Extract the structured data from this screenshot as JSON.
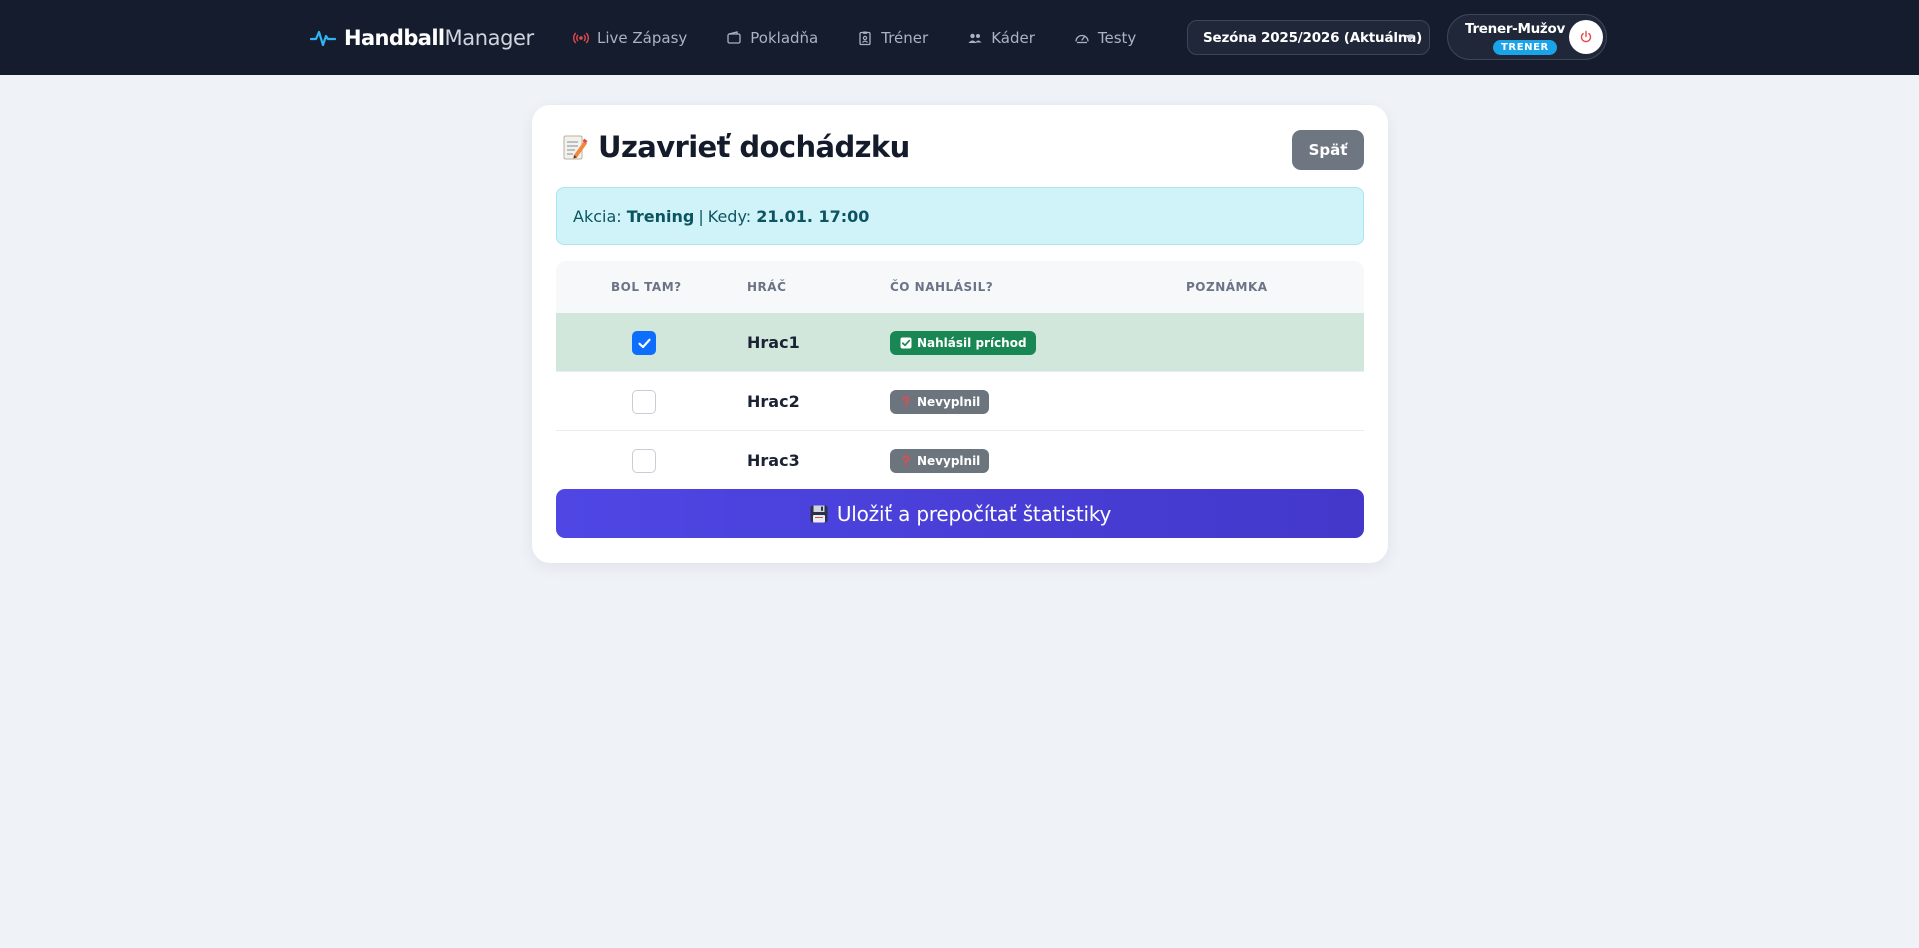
{
  "brand": {
    "bold": "Handball",
    "light": "Manager"
  },
  "nav": [
    {
      "label": "Live Zápasy",
      "icon": "broadcast-icon"
    },
    {
      "label": "Pokladňa",
      "icon": "wallet-icon"
    },
    {
      "label": "Tréner",
      "icon": "clipboard-icon"
    },
    {
      "label": "Káder",
      "icon": "people-icon"
    },
    {
      "label": "Testy",
      "icon": "speedometer-icon"
    }
  ],
  "season": {
    "selected": "Sezóna 2025/2026 (Aktuálna)"
  },
  "user": {
    "name": "Trener-Mužov",
    "role": "TRENER"
  },
  "page": {
    "title": "Uzavrieť dochádzku",
    "back_label": "Späť"
  },
  "info": {
    "event_label": "Akcia:",
    "event": "Trening",
    "separator": "|",
    "when_label": "Kedy:",
    "when": "21.01. 17:00"
  },
  "table": {
    "headers": [
      "BOL TAM?",
      "HRÁČ",
      "ČO NAHLÁSIL?",
      "POZNÁMKA"
    ],
    "rows": [
      {
        "present": true,
        "player": "Hrac1",
        "reported": "Nahlásil príchod",
        "status": "ok",
        "note": ""
      },
      {
        "present": false,
        "player": "Hrac2",
        "reported": "Nevyplnil",
        "status": "none",
        "note": ""
      },
      {
        "present": false,
        "player": "Hrac3",
        "reported": "Nevyplnil",
        "status": "none",
        "note": ""
      }
    ]
  },
  "save_label": "Uložiť a prepočítať štatistiky",
  "colors": {
    "navbar": "#151c2d",
    "accent": "#1aa3e8",
    "primary": "#4f46e5",
    "success": "#198754",
    "secondary": "#6c757d"
  }
}
